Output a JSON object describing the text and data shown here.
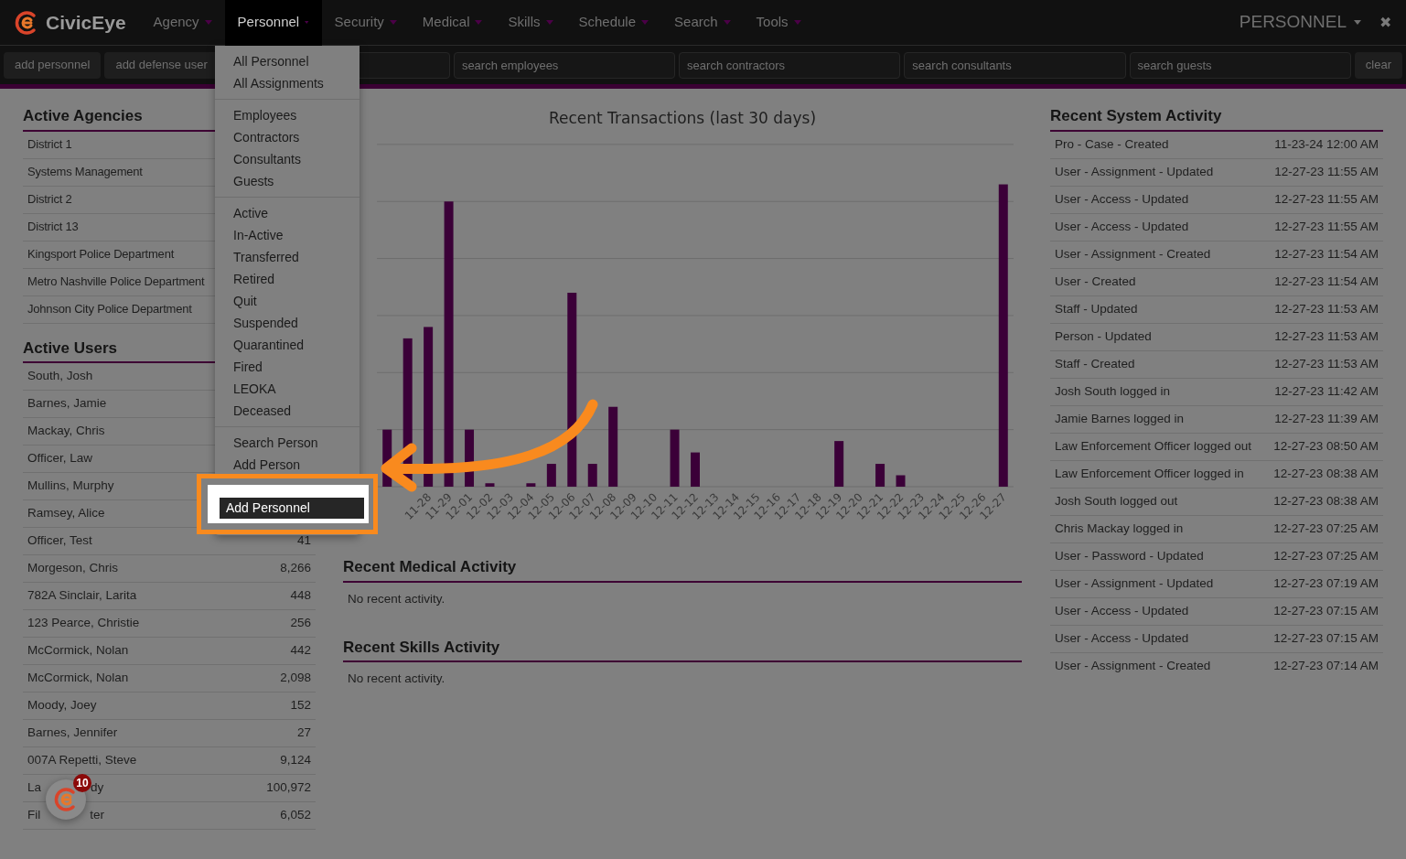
{
  "brand": "CivicEye",
  "nav": [
    {
      "label": "Agency",
      "selected": false
    },
    {
      "label": "Personnel",
      "selected": true
    },
    {
      "label": "Security",
      "selected": false
    },
    {
      "label": "Medical",
      "selected": false
    },
    {
      "label": "Skills",
      "selected": false
    },
    {
      "label": "Schedule",
      "selected": false
    },
    {
      "label": "Search",
      "selected": false
    },
    {
      "label": "Tools",
      "selected": false
    }
  ],
  "account_menu": "PERSONNEL",
  "close_symbol": "✖",
  "toolbar": {
    "buttons": [
      "add personnel",
      "add defense user"
    ],
    "searches": [
      {
        "placeholder": "search employees"
      },
      {
        "placeholder": "search contractors"
      },
      {
        "placeholder": "search consultants"
      },
      {
        "placeholder": "search guests"
      }
    ],
    "clear": "clear"
  },
  "personnel_menu": {
    "sections": [
      [
        "All Personnel",
        "All Assignments"
      ],
      [
        "Employees",
        "Contractors",
        "Consultants",
        "Guests"
      ],
      [
        "Active",
        "In-Active",
        "Transferred",
        "Retired",
        "Quit",
        "Suspended",
        "Quarantined",
        "Fired",
        "LEOKA",
        "Deceased"
      ],
      [
        "Search Person",
        "Add Person"
      ]
    ],
    "highlighted": "Add Personnel"
  },
  "active_agencies": {
    "title": "Active Agencies",
    "items": [
      "District 1",
      "Systems Management",
      "District 2",
      "District 13",
      "Kingsport Police Department",
      "Metro Nashville Police Department",
      "Johnson City Police Department"
    ]
  },
  "active_users": {
    "title": "Active Users",
    "rows": [
      {
        "name": [
          "South, Josh"
        ]
      },
      {
        "name": [
          "Barnes, Jamie"
        ]
      },
      {
        "name": [
          "Mackay, Chris"
        ]
      },
      {
        "name": [
          "Officer, Law"
        ]
      },
      {
        "name": [
          "Mullins, Murphy"
        ]
      },
      {
        "name": [
          "Ramsey, Alice"
        ]
      },
      {
        "name": [
          "Officer, Test"
        ],
        "count": "41"
      },
      {
        "name": [
          "Morgeson, Chris"
        ],
        "count": "8,266"
      },
      {
        "name": [
          "782A Sinclair, Larita"
        ],
        "count": "448"
      },
      {
        "name": [
          "123 Pearce, Christie"
        ],
        "count": "256"
      },
      {
        "name": [
          "McCormick, Nolan"
        ],
        "count": "442"
      },
      {
        "name": [
          "McCormick, Nolan"
        ],
        "count": "2,098"
      },
      {
        "name": [
          "Moody, Joey"
        ],
        "count": "152"
      },
      {
        "name": [
          "Barnes, Jennifer"
        ],
        "count": "27"
      },
      {
        "name": [
          "007A Repetti, Steve"
        ],
        "count": "9,124"
      },
      {
        "name": [
          "La",
          "dy"
        ],
        "count": "100,972"
      },
      {
        "name": [
          "Fil",
          "ter"
        ],
        "count": "6,052"
      }
    ]
  },
  "chart": {
    "title": "Recent Transactions (last 30 days)",
    "x_labels": [
      "11-28",
      "11-29",
      "12-01",
      "12-02",
      "12-03",
      "12-04",
      "12-05",
      "12-06",
      "12-07",
      "12-08",
      "12-09",
      "12-10",
      "12-11",
      "12-12",
      "12-13",
      "12-14",
      "12-15",
      "12-16",
      "12-17",
      "12-18",
      "12-19",
      "12-20",
      "12-21",
      "12-22",
      "12-23",
      "12-24",
      "12-25",
      "12-26",
      "12-27"
    ]
  },
  "medical": {
    "title": "Recent Medical Activity",
    "empty": "No recent activity."
  },
  "skills": {
    "title": "Recent Skills Activity",
    "empty": "No recent activity."
  },
  "system_activity": {
    "title": "Recent System Activity",
    "rows": [
      {
        "event": "Pro - Case - Created",
        "time": "11-23-24 12:00 AM"
      },
      {
        "event": "User - Assignment - Updated",
        "time": "12-27-23 11:55 AM"
      },
      {
        "event": "User - Access - Updated",
        "time": "12-27-23 11:55 AM"
      },
      {
        "event": "User - Access - Updated",
        "time": "12-27-23 11:55 AM"
      },
      {
        "event": "User - Assignment - Created",
        "time": "12-27-23 11:54 AM"
      },
      {
        "event": "User - Created",
        "time": "12-27-23 11:54 AM"
      },
      {
        "event": "Staff - Updated",
        "time": "12-27-23 11:53 AM"
      },
      {
        "event": "Person - Updated",
        "time": "12-27-23 11:53 AM"
      },
      {
        "event": "Staff - Created",
        "time": "12-27-23 11:53 AM"
      },
      {
        "event": "Josh South logged in",
        "time": "12-27-23 11:42 AM"
      },
      {
        "event": "Jamie Barnes logged in",
        "time": "12-27-23 11:39 AM"
      },
      {
        "event": "Law Enforcement Officer logged out",
        "time": "12-27-23 08:50 AM"
      },
      {
        "event": "Law Enforcement Officer logged in",
        "time": "12-27-23 08:38 AM"
      },
      {
        "event": "Josh South logged out",
        "time": "12-27-23 08:38 AM"
      },
      {
        "event": "Chris Mackay logged in",
        "time": "12-27-23 07:25 AM"
      },
      {
        "event": "User - Password - Updated",
        "time": "12-27-23 07:25 AM"
      },
      {
        "event": "User - Assignment - Updated",
        "time": "12-27-23 07:19 AM"
      },
      {
        "event": "User - Access - Updated",
        "time": "12-27-23 07:15 AM"
      },
      {
        "event": "User - Access - Updated",
        "time": "12-27-23 07:15 AM"
      },
      {
        "event": "User - Assignment - Created",
        "time": "12-27-23 07:14 AM"
      }
    ]
  },
  "notifications": {
    "badge": "10"
  }
}
